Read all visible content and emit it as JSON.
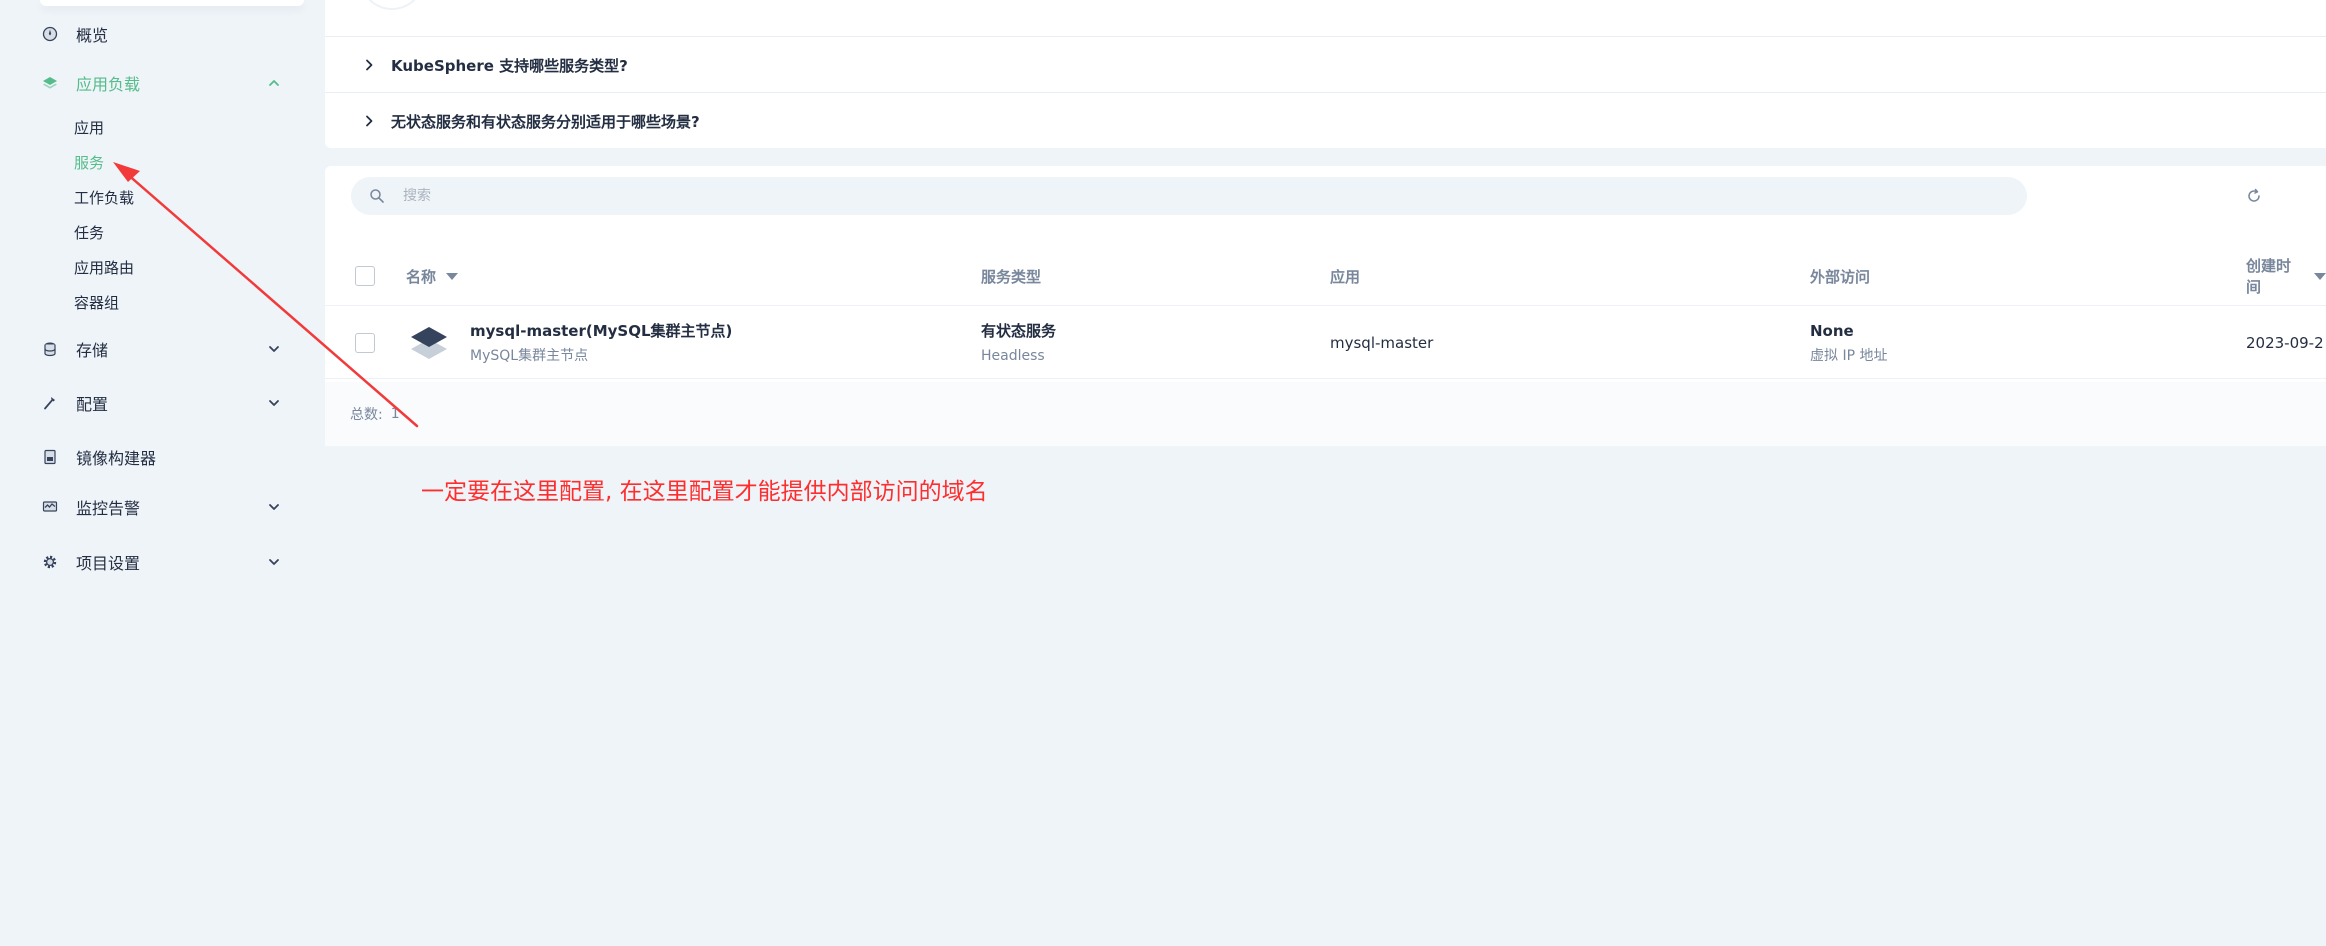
{
  "sidebar": {
    "items": [
      {
        "label": "概览",
        "icon": "dashboard-icon"
      },
      {
        "label": "应用负载",
        "icon": "layers-icon",
        "expanded": true,
        "active": true
      },
      {
        "label": "存储",
        "icon": "database-icon"
      },
      {
        "label": "配置",
        "icon": "hammer-icon"
      },
      {
        "label": "镜像构建器",
        "icon": "image-builder-icon"
      },
      {
        "label": "监控告警",
        "icon": "monitor-icon"
      },
      {
        "label": "项目设置",
        "icon": "gear-icon"
      }
    ],
    "workload_subitems": [
      {
        "label": "应用"
      },
      {
        "label": "服务",
        "active": true
      },
      {
        "label": "工作负载"
      },
      {
        "label": "任务"
      },
      {
        "label": "应用路由"
      },
      {
        "label": "容器组"
      }
    ]
  },
  "faq": {
    "items": [
      {
        "question": "KubeSphere 支持哪些服务类型?"
      },
      {
        "question": "无状态服务和有状态服务分别适用于哪些场景?"
      }
    ]
  },
  "search": {
    "placeholder": "搜索"
  },
  "table": {
    "columns": {
      "name": "名称",
      "service_type": "服务类型",
      "app": "应用",
      "external_access": "外部访问",
      "created_at": "创建时间"
    },
    "rows": [
      {
        "name": "mysql-master(MySQL集群主节点)",
        "description": "MySQL集群主节点",
        "service_type": "有状态服务",
        "service_subtype": "Headless",
        "app": "mysql-master",
        "external_access": "None",
        "external_access_detail": "虚拟 IP 地址",
        "created_at": "2023-09-2"
      }
    ],
    "total_label": "总数:",
    "total": "1"
  },
  "annotation": {
    "text": "一定要在这里配置, 在这里配置才能提供内部访问的域名",
    "color": "#ff2e2e"
  },
  "colors": {
    "accent": "#55bc8a",
    "text": "#242e42",
    "muted": "#79879c",
    "background": "#eff4f9"
  }
}
